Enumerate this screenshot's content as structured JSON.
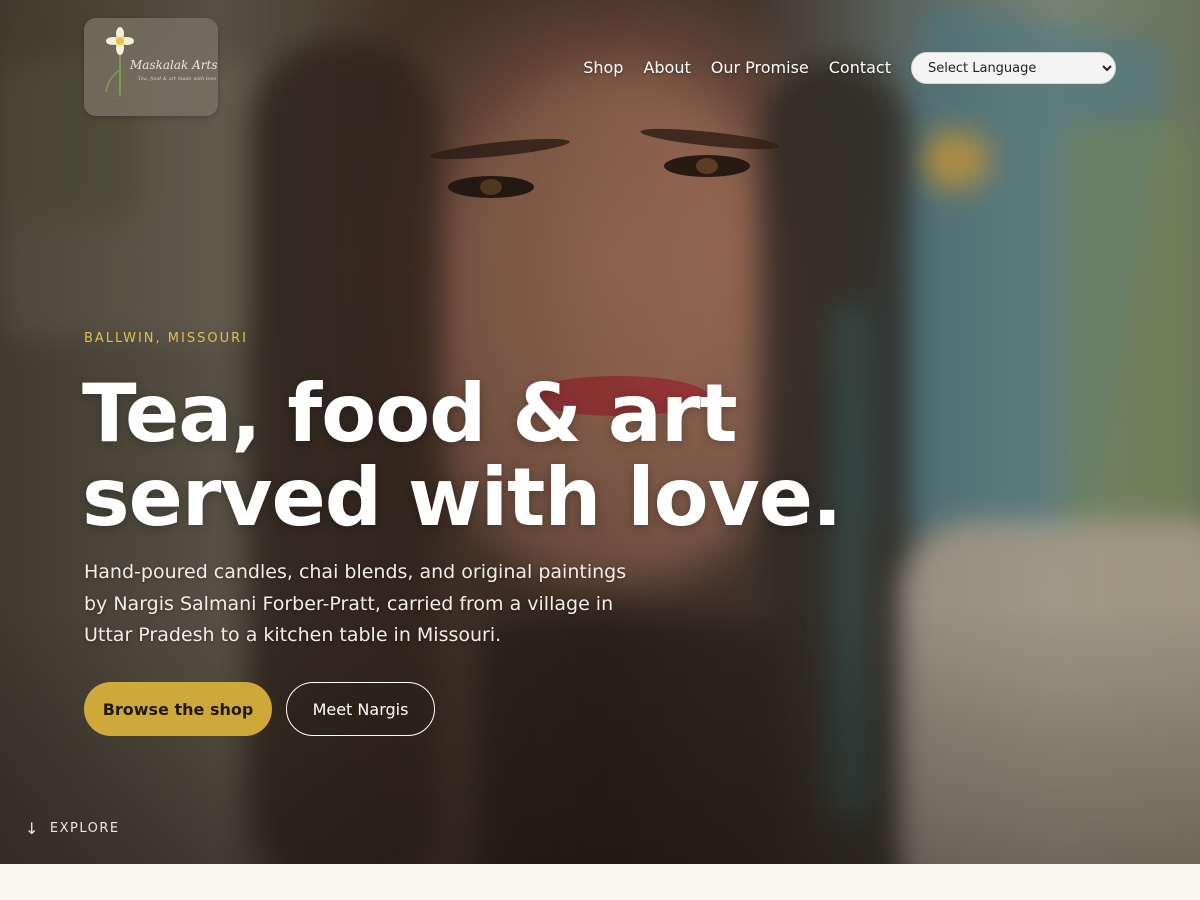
{
  "brand": {
    "logo_text": "Maskalak Arts",
    "logo_tagline": "Tea, food & art made with love"
  },
  "nav": {
    "items": [
      "Shop",
      "About",
      "Our Promise",
      "Contact"
    ],
    "language_select": {
      "selected": "Select Language"
    }
  },
  "hero": {
    "eyebrow": "BALLWIN, MISSOURI",
    "headline_line1": "Tea, food & art",
    "headline_line2": "served with love.",
    "description": "Hand-poured candles, chai blends, and original paintings by Nargis Salmani Forber-Pratt, carried from a village in Uttar Pradesh to a kitchen table in Missouri.",
    "primary_button": "Browse the shop",
    "secondary_button": "Meet Nargis",
    "scroll_hint": "EXPLORE",
    "scroll_icon": "arrow-down-icon"
  },
  "colors": {
    "accent": "#cfa83a",
    "eyebrow": "#e1bf52",
    "page_background": "#f8f6f1"
  }
}
